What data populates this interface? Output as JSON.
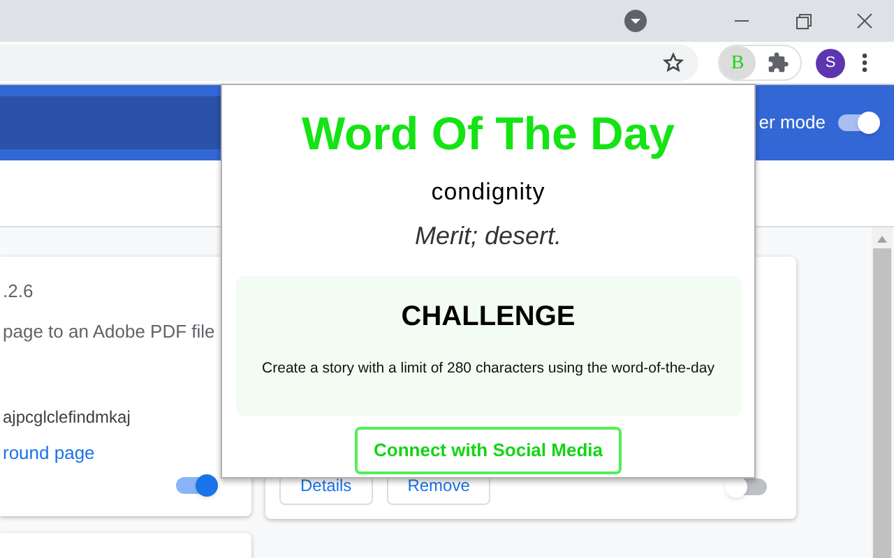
{
  "browser": {
    "profile_initial": "S",
    "extension_letter": "B"
  },
  "header": {
    "mode_label": "er mode",
    "developer_mode": {
      "on": true
    }
  },
  "cards": [
    {
      "texts": [
        ".2.6",
        "page to an Adobe PDF file",
        "ajpcglclefindmkaj"
      ],
      "link": "round page",
      "enabled": {
        "on": true
      }
    },
    {
      "buttons": [
        "Details",
        "Remove"
      ],
      "enabled": {
        "on": false
      }
    }
  ],
  "popup": {
    "title": "Word Of The Day",
    "word": "condignity",
    "definition": "Merit; desert.",
    "challenge": {
      "title": "CHALLENGE",
      "text": "Create a story with a limit of 280 characters using the word-of-the-day"
    },
    "button": "Connect with Social Media"
  }
}
